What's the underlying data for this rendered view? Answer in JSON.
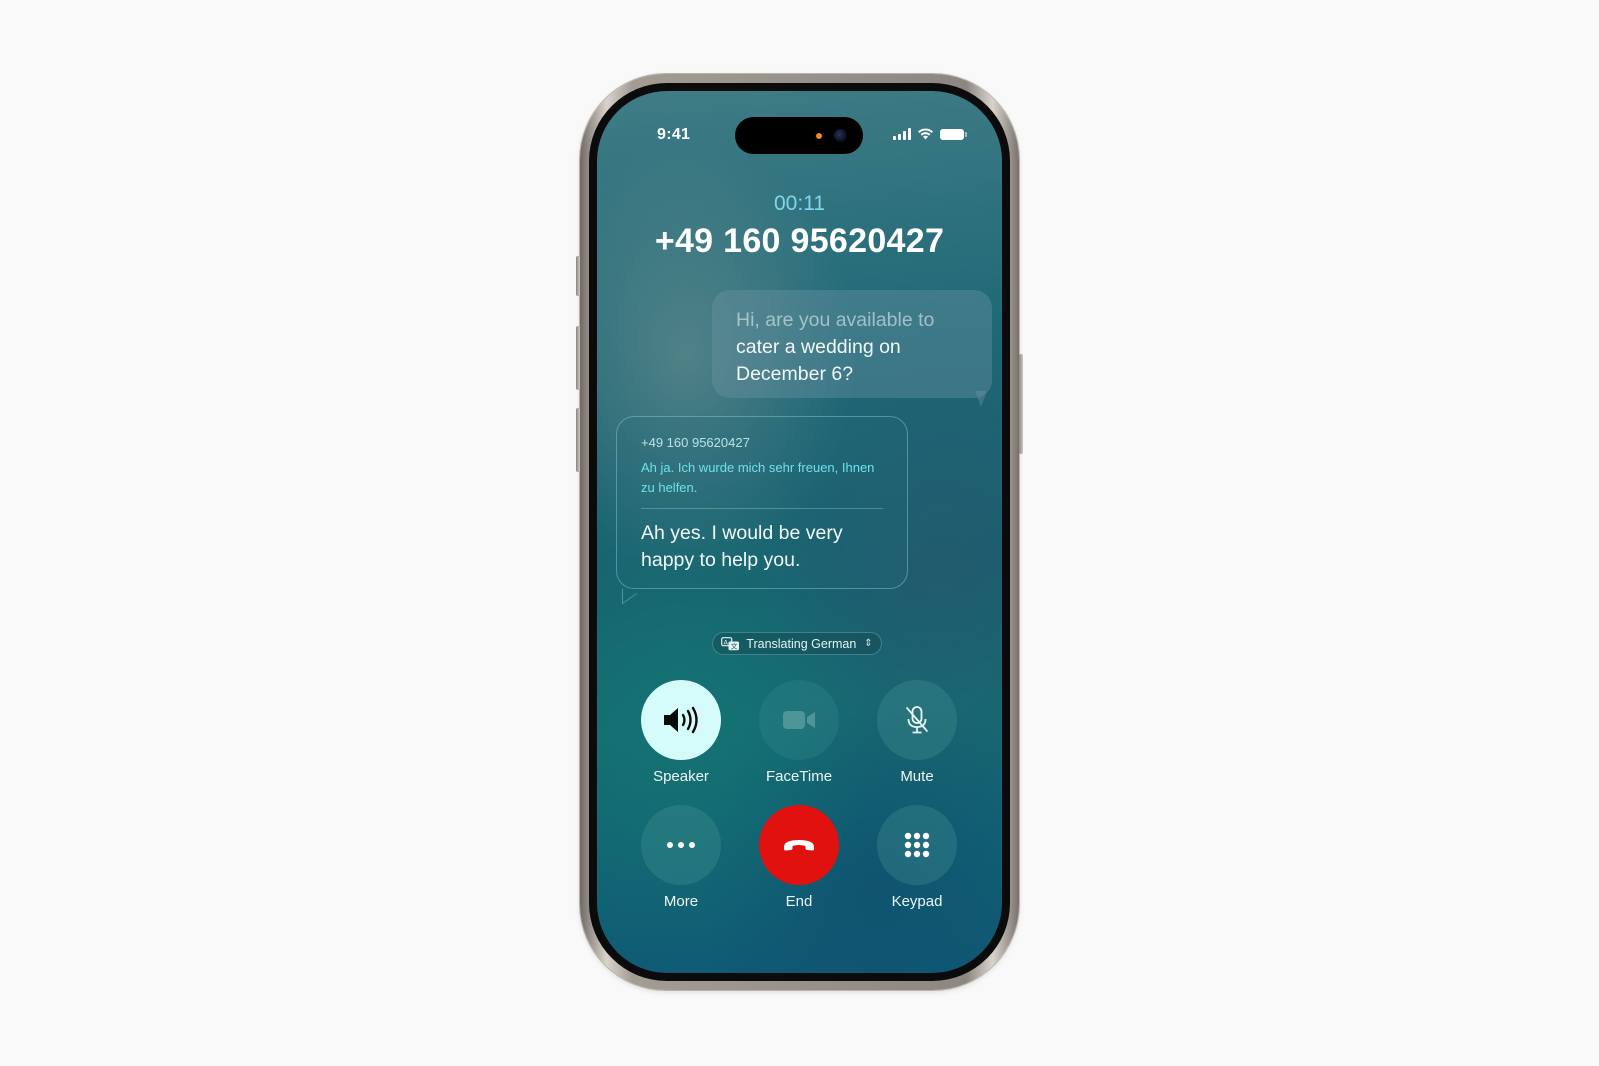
{
  "status_bar": {
    "time": "9:41",
    "icons": [
      "cellular-signal-icon",
      "wifi-icon",
      "battery-icon"
    ]
  },
  "call": {
    "timer": "00:11",
    "number": "+49 160 95620427"
  },
  "outgoing_message": {
    "line1": "Hi, are you available to",
    "line2": "cater a wedding on",
    "line3": "December 6?"
  },
  "incoming_message": {
    "caller": "+49 160 95620427",
    "original": "Ah ja. Ich wurde mich sehr freuen, Ihnen zu helfen.",
    "translation": "Ah yes. I would be very happy to help you."
  },
  "translation_pill": {
    "label": "Translating German",
    "icon": "translate-icon"
  },
  "controls": {
    "speaker": {
      "label": "Speaker",
      "icon": "speaker-icon",
      "active": true
    },
    "facetime": {
      "label": "FaceTime",
      "icon": "video-camera-icon",
      "enabled": false
    },
    "mute": {
      "label": "Mute",
      "icon": "mic-off-icon"
    },
    "more": {
      "label": "More",
      "icon": "ellipsis-icon"
    },
    "end": {
      "label": "End",
      "icon": "hang-up-icon"
    },
    "keypad": {
      "label": "Keypad",
      "icon": "keypad-icon"
    }
  },
  "colors": {
    "timer": "#7fd7ee",
    "end_button": "#e0110f",
    "speaker_active": "#d6fbfb",
    "original_text": "#6fe0ea"
  }
}
